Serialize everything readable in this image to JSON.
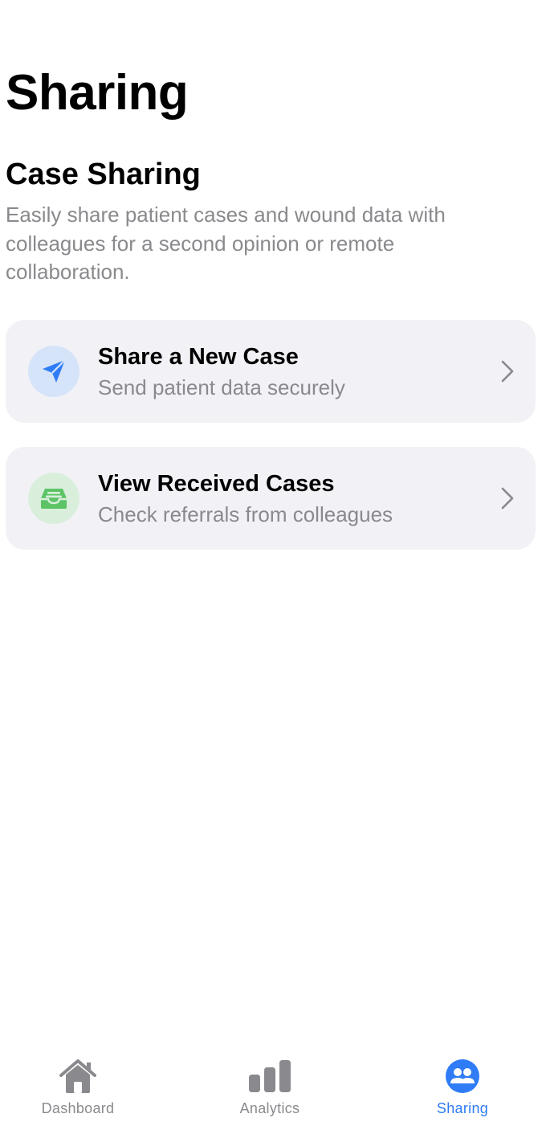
{
  "header": {
    "title": "Sharing"
  },
  "section": {
    "title": "Case Sharing",
    "description": "Easily share patient cases and wound data with colleagues for a second opinion or remote collaboration."
  },
  "cards": [
    {
      "title": "Share a New Case",
      "subtitle": "Send patient data securely",
      "icon": "paper-plane-icon",
      "icon_color": "#2f7cf6",
      "icon_bg": "#d6e4fa"
    },
    {
      "title": "View Received Cases",
      "subtitle": "Check referrals from colleagues",
      "icon": "tray-icon",
      "icon_color": "#5cc466",
      "icon_bg": "#d9efdc"
    }
  ],
  "tab_bar": {
    "tabs": [
      {
        "label": "Dashboard",
        "icon": "house-icon",
        "active": false
      },
      {
        "label": "Analytics",
        "icon": "bar-chart-icon",
        "active": false
      },
      {
        "label": "Sharing",
        "icon": "people-icon",
        "active": true
      }
    ],
    "active_color": "#2f7cf6",
    "inactive_color": "#8a8a8e"
  }
}
